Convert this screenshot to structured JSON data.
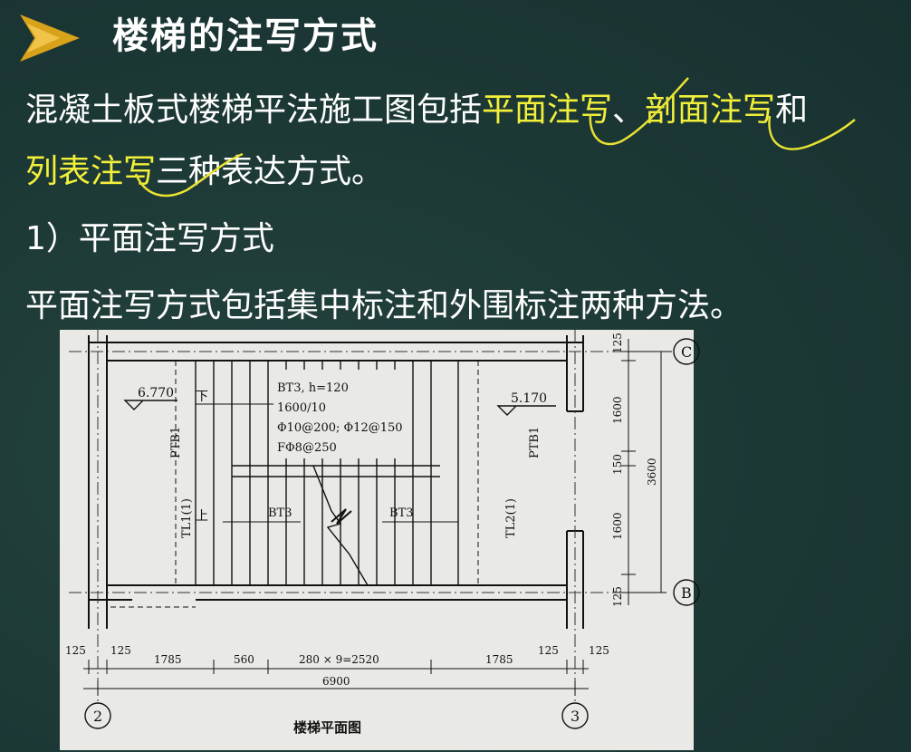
{
  "slide": {
    "title": "楼梯的注写方式",
    "para1": {
      "prefix": "混凝土板式楼梯平法施工图包括",
      "hl1": "平面注写",
      "sep": "、",
      "hl2": "剖面注写",
      "suffix": "和"
    },
    "para2": {
      "hl3": "列表注写",
      "suffix": "三种表达方式。"
    },
    "section_heading": "1）平面注写方式",
    "para3": "平面注写方式包括集中标注和外围标注两种方法。",
    "colors": {
      "background": "#1d3a37",
      "text": "#ffffff",
      "highlight": "#f2ef3a",
      "icon": "#d9a21b"
    },
    "icon": "play-triangle-icon"
  },
  "drawing": {
    "caption": "楼梯平面图",
    "axis_labels": {
      "c": "C",
      "b": "B",
      "two": "2",
      "three": "3"
    },
    "level_left": "6.770",
    "level_right": "5.170",
    "arrow_down": "下",
    "arrow_up": "上",
    "panel_label_left": "PTB1",
    "panel_label_right": "PTB1",
    "beam_label_left": "TL1(1)",
    "beam_label_right": "TL2(1)",
    "flight_label_left": "BT3",
    "flight_label_right": "BT3",
    "annotation": {
      "line1": "BT3, h=120",
      "line2": "1600/10",
      "line3": "Φ10@200; Φ12@150",
      "line4": "FΦ8@250"
    },
    "dims_right": [
      "125",
      "1600",
      "150",
      "1600",
      "125"
    ],
    "dim_total_right": "3600",
    "dims_bottom": [
      "125",
      "125",
      "1785",
      "560",
      "280 × 9=2520",
      "1785",
      "125",
      "125"
    ],
    "dim_total_bottom": "6900"
  }
}
